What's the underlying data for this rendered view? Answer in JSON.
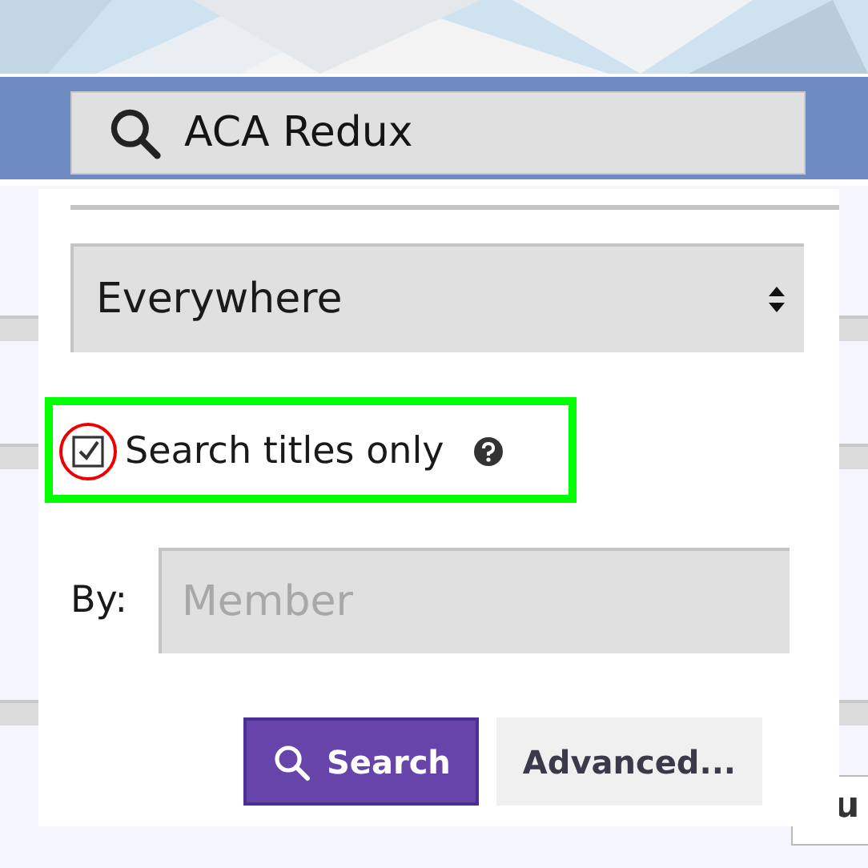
{
  "search_bar": {
    "value": "ACA Redux"
  },
  "search_menu": {
    "scope_select": {
      "value": "Everywhere"
    },
    "titles_only": {
      "label": "Search titles only",
      "checked": true
    },
    "by": {
      "label": "By:",
      "placeholder": "Member"
    },
    "buttons": [
      {
        "label": "Search",
        "kind": "primary"
      },
      {
        "label": "Advanced...",
        "kind": "secondary"
      }
    ]
  },
  "background": {
    "fragment": "u"
  }
}
